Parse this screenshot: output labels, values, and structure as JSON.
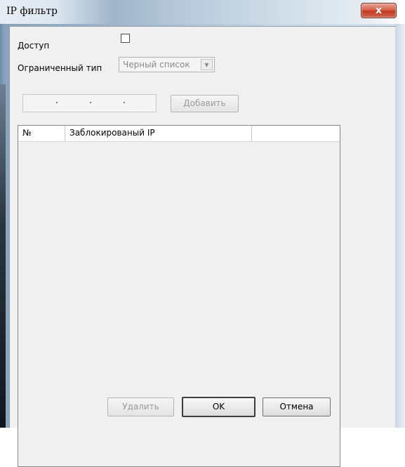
{
  "window": {
    "title": "IP фильтр",
    "close_glyph": "x"
  },
  "form": {
    "enable_label": "Доступ",
    "enable_checked": false,
    "restricted_type_label": "Ограниченный тип",
    "restricted_type_value": "Черный список",
    "ip_address_value": "",
    "add_button": "Добавить"
  },
  "table": {
    "columns": [
      "№",
      "Заблокированый IP",
      ""
    ],
    "rows": []
  },
  "buttons": {
    "delete": "Удалить",
    "ok": "OK",
    "cancel": "Отмена"
  },
  "icons": {
    "close": "close-icon",
    "dropdown": "chevron-down-icon"
  },
  "colors": {
    "close_button": "#c13b22",
    "dialog_background": "#f0f0f0"
  }
}
